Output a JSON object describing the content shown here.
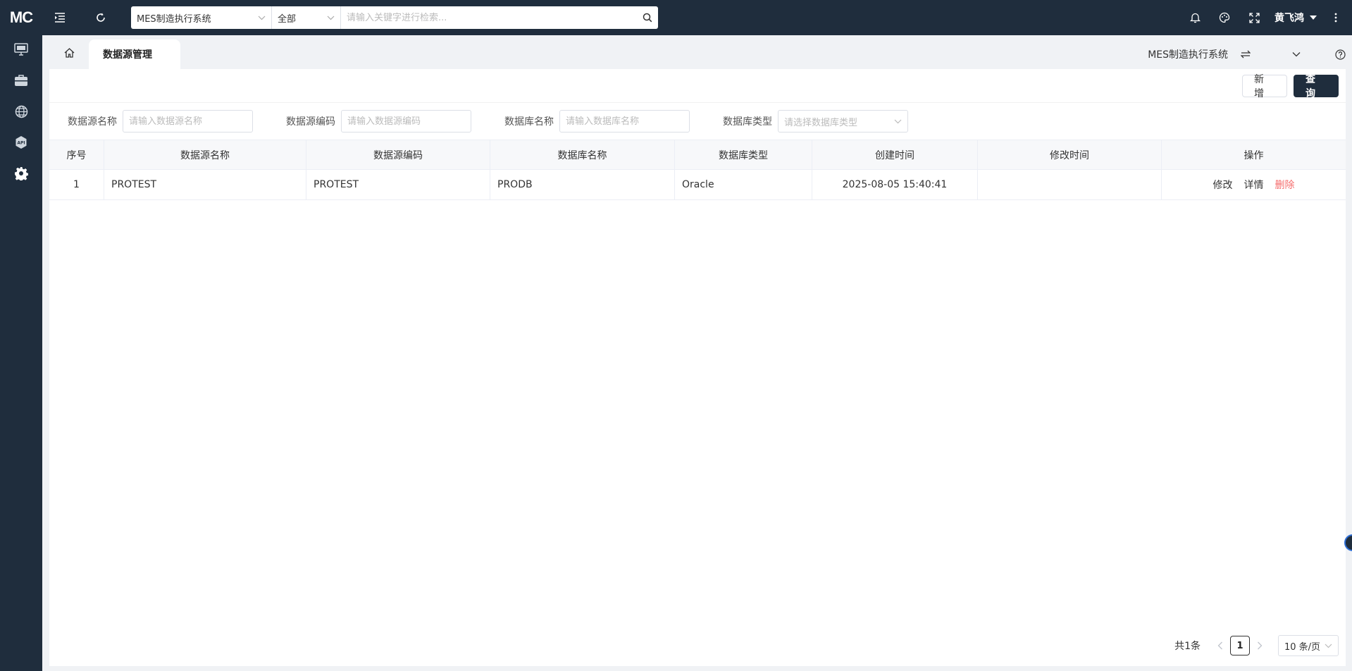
{
  "topbar": {
    "logo": "MC",
    "system_select": "MES制造执行系统",
    "scope_select": "全部",
    "search_placeholder": "请输入关键字进行检索...",
    "user_name": "黄飞鸿"
  },
  "sidebar": {
    "items": [
      {
        "icon": "monitor-icon"
      },
      {
        "icon": "briefcase-icon"
      },
      {
        "icon": "globe-icon"
      },
      {
        "icon": "api-icon"
      },
      {
        "icon": "gear-icon",
        "active": true
      }
    ]
  },
  "tabs": {
    "active_tab": "数据源管理",
    "system_label": "MES制造执行系统"
  },
  "toolbar": {
    "add_label": "新 增",
    "query_label": "查 询"
  },
  "filters": {
    "ds_name_label": "数据源名称",
    "ds_name_placeholder": "请输入数据源名称",
    "ds_code_label": "数据源编码",
    "ds_code_placeholder": "请输入数据源编码",
    "db_name_label": "数据库名称",
    "db_name_placeholder": "请输入数据库名称",
    "db_type_label": "数据库类型",
    "db_type_placeholder": "请选择数据库类型"
  },
  "table": {
    "headers": {
      "idx": "序号",
      "ds_name": "数据源名称",
      "ds_code": "数据源编码",
      "db_name": "数据库名称",
      "db_type": "数据库类型",
      "created": "创建时间",
      "modified": "修改时间",
      "ops": "操作"
    },
    "rows": [
      {
        "idx": "1",
        "ds_name": "PROTEST",
        "ds_code": "PROTEST",
        "db_name": "PRODB",
        "db_type": "Oracle",
        "created": "2025-08-05 15:40:41",
        "modified": "",
        "edit": "修改",
        "detail": "详情",
        "delete": "删除"
      }
    ]
  },
  "pagination": {
    "total": "共1条",
    "current_page": "1",
    "page_size": "10 条/页"
  },
  "colors": {
    "nav_bg": "#1f2d3d",
    "primary": "#1f2d3d",
    "danger": "#f56c6c"
  }
}
